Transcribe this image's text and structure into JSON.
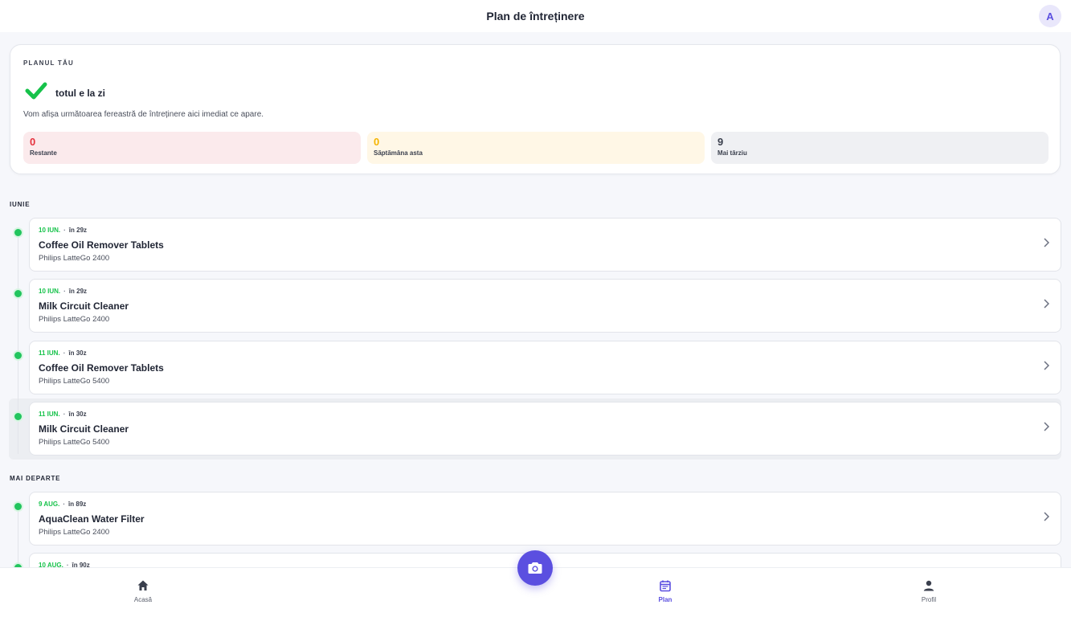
{
  "header": {
    "title": "Plan de întreținere",
    "avatar_initial": "A"
  },
  "plan": {
    "eyebrow": "PLANUL TĂU",
    "status": "totul e la zi",
    "subtitle": "Vom afișa următoarea fereastră de întreținere aici imediat ce apare.",
    "stats": [
      {
        "value": "0",
        "label": "Restante",
        "color": "#e5323e"
      },
      {
        "value": "0",
        "label": "Săptămâna asta",
        "color": "#f5b400"
      },
      {
        "value": "9",
        "label": "Mai târziu",
        "color": "#3a3f4d"
      }
    ]
  },
  "sections": [
    {
      "label": "IUNIE",
      "tasks": [
        {
          "date": "10 IUN.",
          "relative": "în 29z",
          "name": "Coffee Oil Remover Tablets",
          "device": "Philips LatteGo 2400"
        },
        {
          "date": "10 IUN.",
          "relative": "în 29z",
          "name": "Milk Circuit Cleaner",
          "device": "Philips LatteGo 2400"
        },
        {
          "date": "11 IUN.",
          "relative": "în 30z",
          "name": "Coffee Oil Remover Tablets",
          "device": "Philips LatteGo 5400"
        },
        {
          "date": "11 IUN.",
          "relative": "în 30z",
          "name": "Milk Circuit Cleaner",
          "device": "Philips LatteGo 5400"
        }
      ]
    },
    {
      "label": "MAI DEPARTE",
      "tasks": [
        {
          "date": "9 AUG.",
          "relative": "în 89z",
          "name": "AquaClean Water Filter",
          "device": "Philips LatteGo 2400"
        },
        {
          "date": "10 AUG.",
          "relative": "în 90z",
          "name": "",
          "device": ""
        }
      ]
    }
  ],
  "nav": {
    "items": [
      {
        "label": "Acasă",
        "icon": "home-icon"
      },
      {
        "label": "Plan",
        "icon": "calendar-icon",
        "active": true
      },
      {
        "label": "Profil",
        "icon": "user-icon"
      }
    ],
    "fab_icon": "camera-icon"
  },
  "colors": {
    "accent": "#5b4fe0",
    "success": "#16c24a",
    "overdue": "#e5323e",
    "warning": "#f5b400"
  }
}
